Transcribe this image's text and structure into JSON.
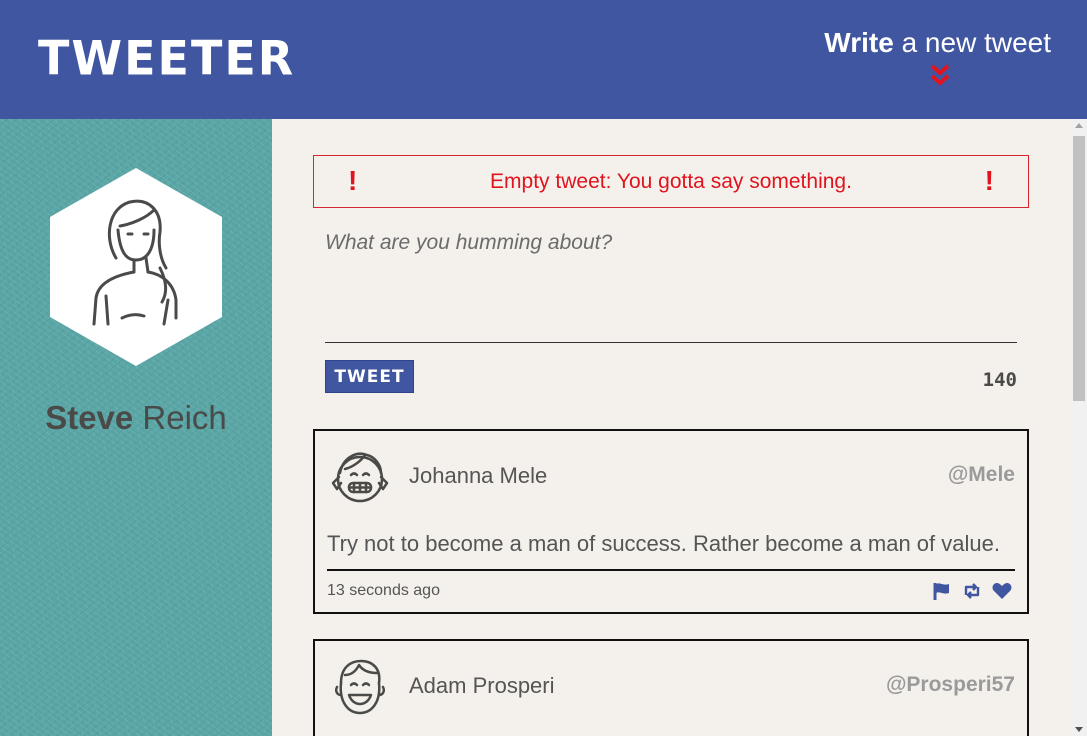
{
  "header": {
    "logo": "TWEETER",
    "compose_bold": "Write",
    "compose_rest": " a new tweet",
    "compose_icon": "double-chevron-down-icon"
  },
  "profile": {
    "first_name": "Steve",
    "last_name": " Reich",
    "avatar_icon": "woman-avatar-icon"
  },
  "error": {
    "message": "Empty tweet: You gotta say something.",
    "left_icon": "!",
    "right_icon": "!"
  },
  "composer": {
    "placeholder": "What are you humming about?",
    "button_label": "TWEET",
    "counter": "140"
  },
  "tweets": [
    {
      "name": "Johanna Mele",
      "handle": "@Mele",
      "body": "Try not to become a man of success. Rather become a man of value.",
      "time": "13 seconds ago",
      "avatar_icon": "girl-avatar-icon"
    },
    {
      "name": "Adam Prosperi",
      "handle": "@Prosperi57",
      "avatar_icon": "boy-avatar-icon"
    }
  ],
  "colors": {
    "header": "#4056a1",
    "sidebar": "#5aa6a6",
    "background": "#f4f1ec",
    "error": "#e0141e",
    "icon": "#4056a1"
  }
}
